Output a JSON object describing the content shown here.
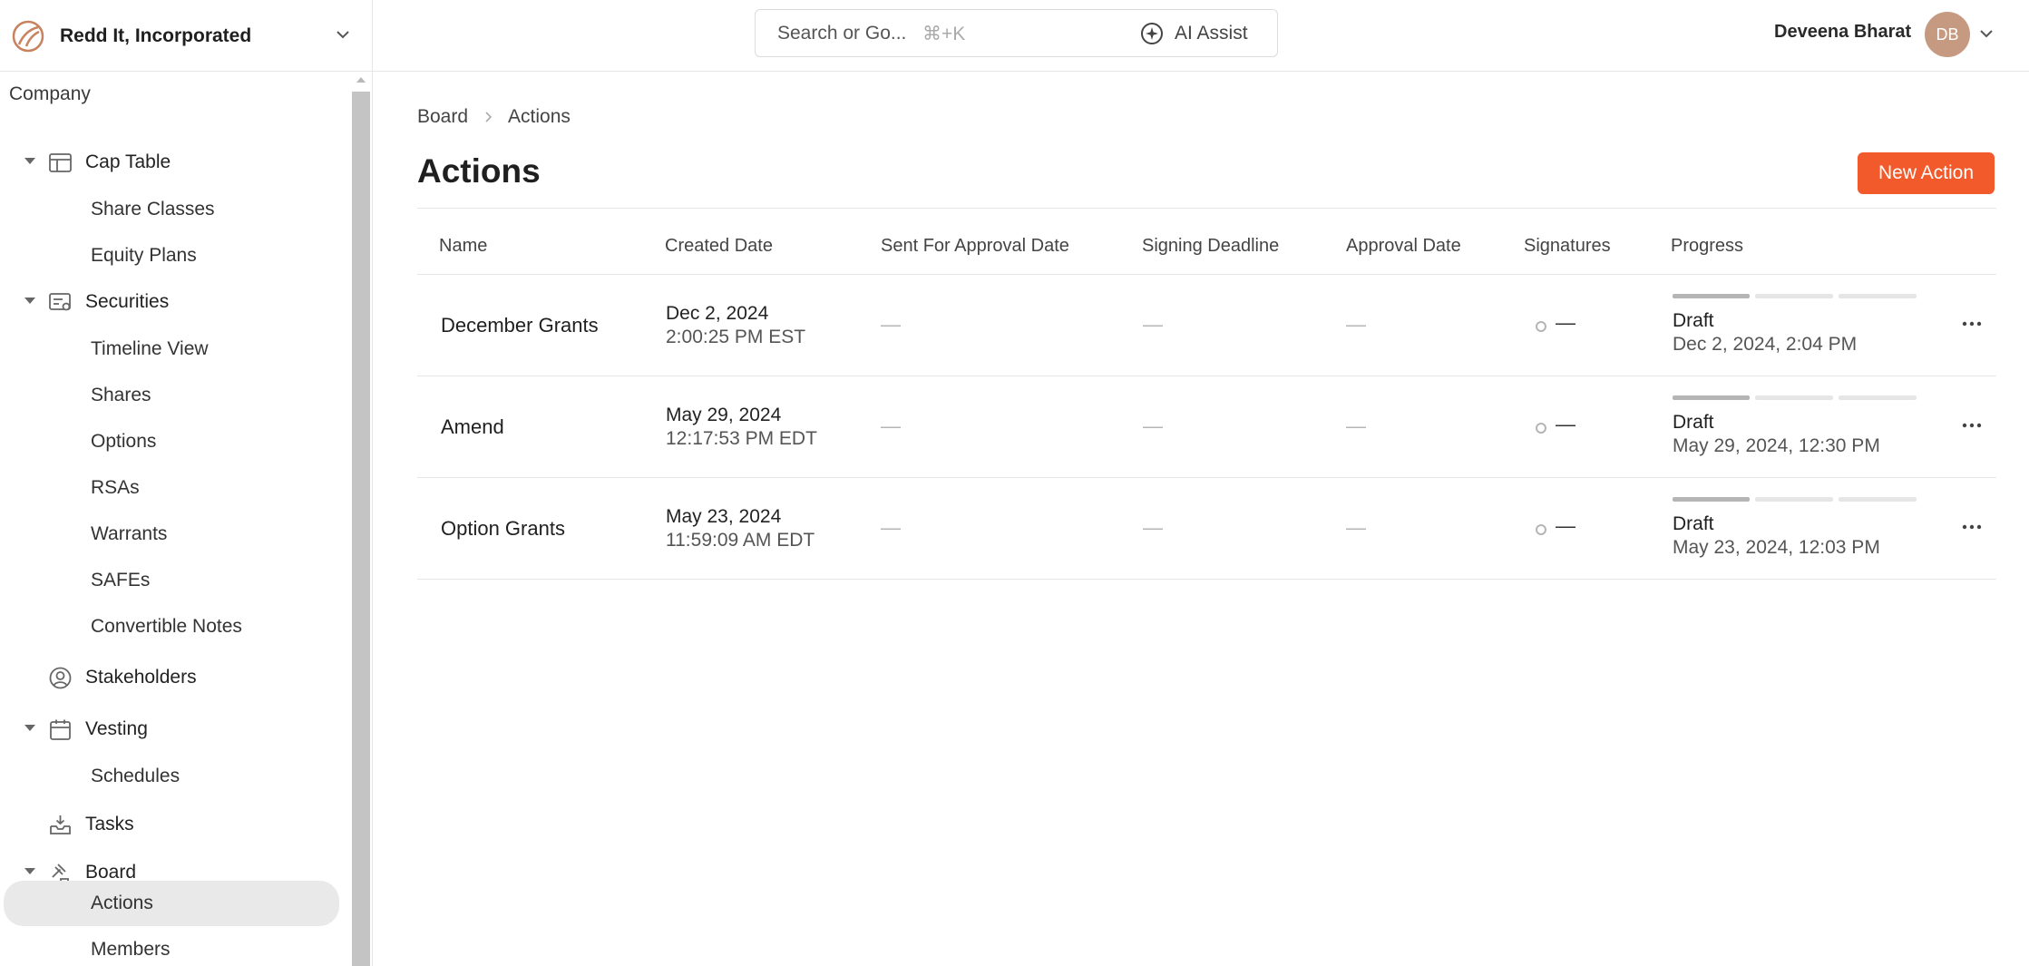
{
  "company": {
    "name": "Redd It, Incorporated"
  },
  "search": {
    "placeholder": "Search or Go...",
    "shortcut": "⌘+K",
    "ai_label": "AI Assist"
  },
  "user": {
    "name": "Deveena Bharat",
    "initials": "DB",
    "avatar_color": "#c69a80"
  },
  "accent": "#f2592b",
  "sidebar": {
    "section": "Company",
    "items": [
      {
        "label": "Cap Table",
        "icon": "table-icon",
        "expanded": true
      },
      {
        "label": "Share Classes"
      },
      {
        "label": "Equity Plans"
      },
      {
        "label": "Securities",
        "icon": "certificate-icon",
        "expanded": true
      },
      {
        "label": "Timeline View"
      },
      {
        "label": "Shares"
      },
      {
        "label": "Options"
      },
      {
        "label": "RSAs"
      },
      {
        "label": "Warrants"
      },
      {
        "label": "SAFEs"
      },
      {
        "label": "Convertible Notes"
      },
      {
        "label": "Stakeholders",
        "icon": "user-circle-icon"
      },
      {
        "label": "Vesting",
        "icon": "calendar-icon",
        "expanded": true
      },
      {
        "label": "Schedules"
      },
      {
        "label": "Tasks",
        "icon": "inbox-icon"
      },
      {
        "label": "Board",
        "icon": "gavel-icon",
        "expanded": true
      },
      {
        "label": "Actions",
        "active": true
      },
      {
        "label": "Members"
      }
    ]
  },
  "breadcrumb": {
    "parent": "Board",
    "current": "Actions"
  },
  "page": {
    "title": "Actions",
    "new_button": "New Action"
  },
  "table": {
    "headers": [
      "Name",
      "Created Date",
      "Sent For Approval Date",
      "Signing Deadline",
      "Approval Date",
      "Signatures",
      "Progress"
    ],
    "rows": [
      {
        "name": "December Grants",
        "created_date": "Dec 2, 2024",
        "created_time": "2:00:25 PM EST",
        "sent": "—",
        "deadline": "—",
        "approval": "—",
        "signatures": "—",
        "progress_status": "Draft",
        "progress_date": "Dec 2, 2024, 2:04 PM",
        "progress_steps_done": 1,
        "progress_steps_total": 3
      },
      {
        "name": "Amend",
        "created_date": "May 29, 2024",
        "created_time": "12:17:53 PM EDT",
        "sent": "—",
        "deadline": "—",
        "approval": "—",
        "signatures": "—",
        "progress_status": "Draft",
        "progress_date": "May 29, 2024, 12:30 PM",
        "progress_steps_done": 1,
        "progress_steps_total": 3
      },
      {
        "name": "Option Grants",
        "created_date": "May 23, 2024",
        "created_time": "11:59:09 AM EDT",
        "sent": "—",
        "deadline": "—",
        "approval": "—",
        "signatures": "—",
        "progress_status": "Draft",
        "progress_date": "May 23, 2024, 12:03 PM",
        "progress_steps_done": 1,
        "progress_steps_total": 3
      }
    ]
  }
}
